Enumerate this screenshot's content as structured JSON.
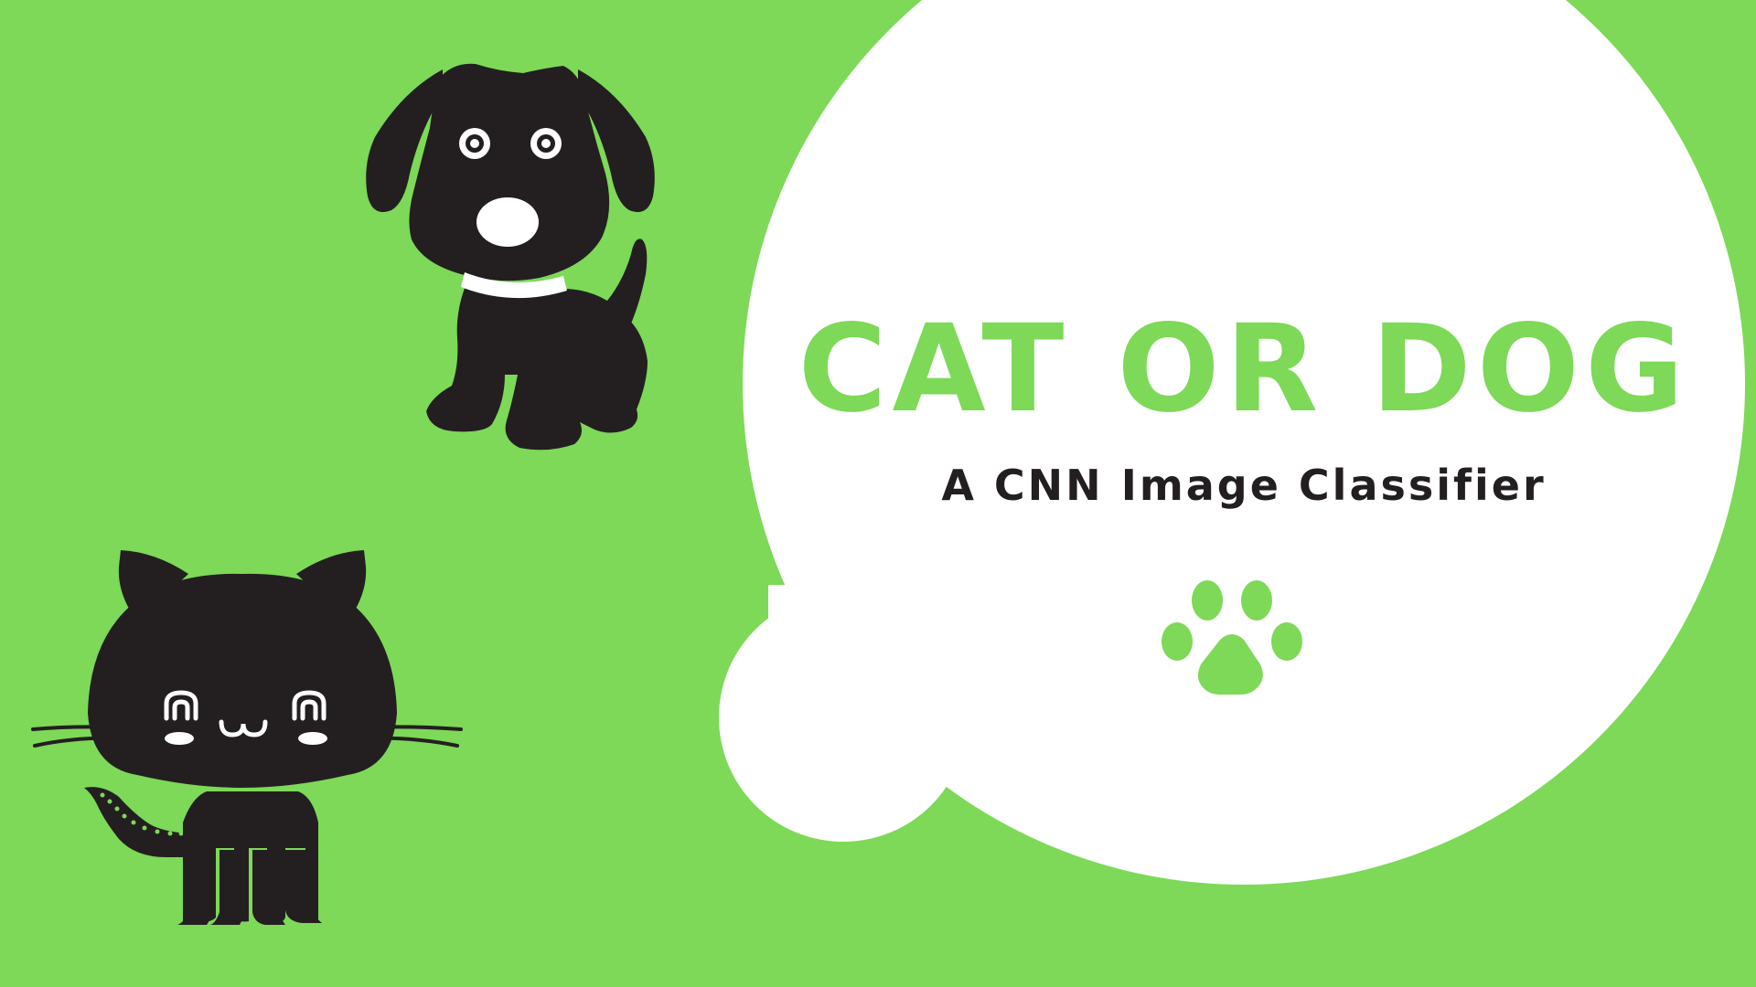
{
  "slide": {
    "title": "CAT OR DOG",
    "subtitle": "A CNN Image Classifier"
  },
  "colors": {
    "background": "#7dd957",
    "bubble": "#ffffff",
    "title": "#7dd957",
    "subtitle": "#231f20",
    "silhouette": "#231f20",
    "paw": "#7dd957"
  },
  "illustrations": {
    "dog": "dog-illustration",
    "cat": "cat-illustration",
    "paw": "paw-print-icon"
  }
}
